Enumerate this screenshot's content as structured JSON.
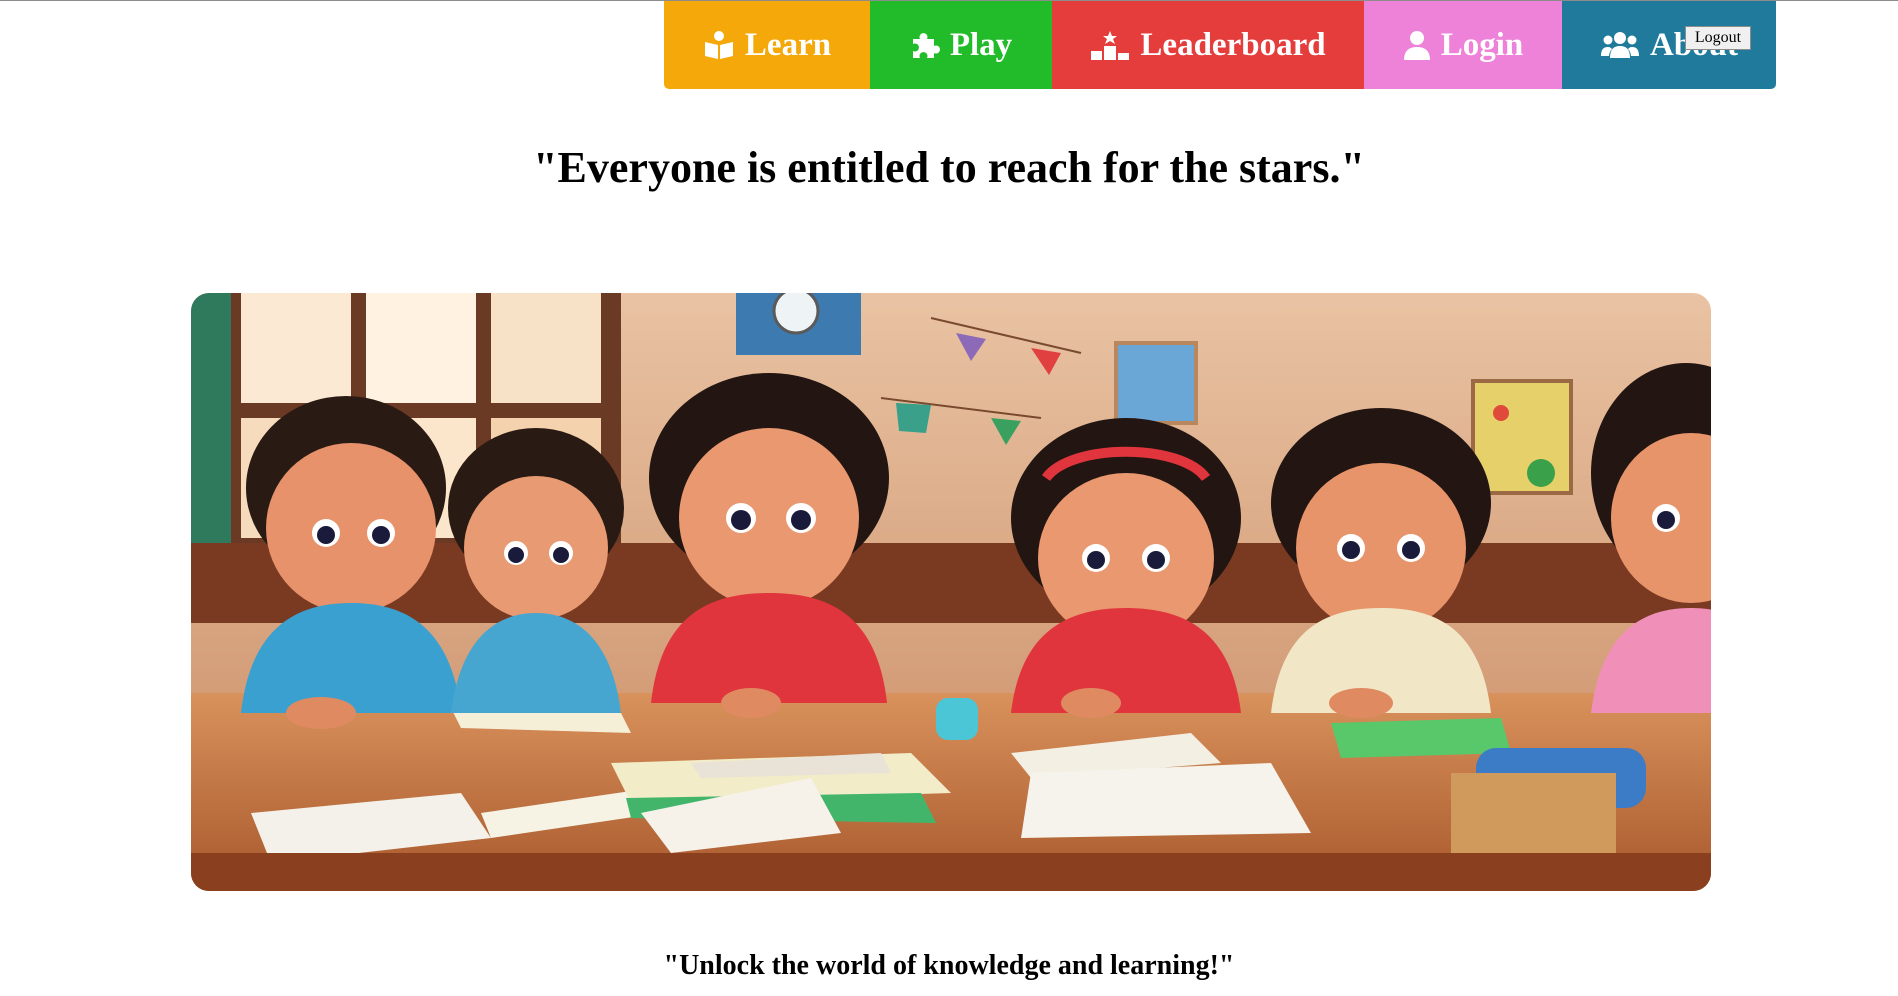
{
  "nav": {
    "items": [
      {
        "label": "Learn",
        "icon": "book-reader-icon",
        "color": "#F5A80A"
      },
      {
        "label": "Play",
        "icon": "puzzle-icon",
        "color": "#22BC2A"
      },
      {
        "label": "Leaderboard",
        "icon": "podium-icon",
        "color": "#E53C3C"
      },
      {
        "label": "Login",
        "icon": "user-icon",
        "color": "#EE82D8"
      },
      {
        "label": "About",
        "icon": "users-icon",
        "color": "#1F7A9C"
      }
    ],
    "logout_label": "Logout"
  },
  "hero": {
    "quote": "\"Everyone is entitled to reach for the stars.\"",
    "image_description_icon": "classroom-kids-image"
  },
  "footer": {
    "quote": "\"Unlock the world of knowledge and learning!\""
  }
}
